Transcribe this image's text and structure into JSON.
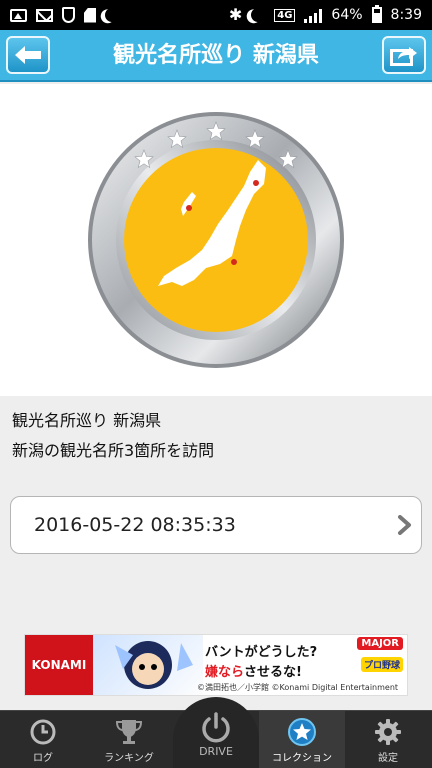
{
  "status_bar": {
    "battery": "64%",
    "network": "4G",
    "time": "8:39",
    "icons": [
      "image-icon",
      "mail-icon",
      "shield-icon",
      "sd-card-icon",
      "moon-icon",
      "bluetooth-icon",
      "moon-icon",
      "signal-icon",
      "battery-icon"
    ]
  },
  "header": {
    "title": "観光名所巡り 新潟県",
    "back_icon": "arrow-left-icon",
    "share_icon": "share-icon"
  },
  "medal": {
    "ring_color": "#b9bcc0",
    "face_color": "#fbbd12",
    "stars": 5,
    "visited_points": 3
  },
  "badge": {
    "name": "観光名所巡り 新潟県",
    "description": "新潟の観光名所3箇所を訪問"
  },
  "history": {
    "datetime": "2016-05-22 08:35:33"
  },
  "ad": {
    "brand": "KONAMI",
    "line1": "バントがどうした?",
    "line2_prefix": "",
    "line2_red": "嫌なら",
    "line2_suffix": "させるな!",
    "tag1": "MAJOR",
    "tag2": "プロ野球",
    "copyright": "©満田拓也／小学館 ©Konami Digital Entertainment"
  },
  "nav": {
    "items": [
      {
        "label": "ログ",
        "icon": "clock-icon"
      },
      {
        "label": "ランキング",
        "icon": "trophy-icon"
      },
      {
        "label": "DRIVE",
        "icon": "power-icon"
      },
      {
        "label": "コレクション",
        "icon": "star-icon"
      },
      {
        "label": "設定",
        "icon": "gear-icon"
      }
    ],
    "active": "コレクション"
  }
}
